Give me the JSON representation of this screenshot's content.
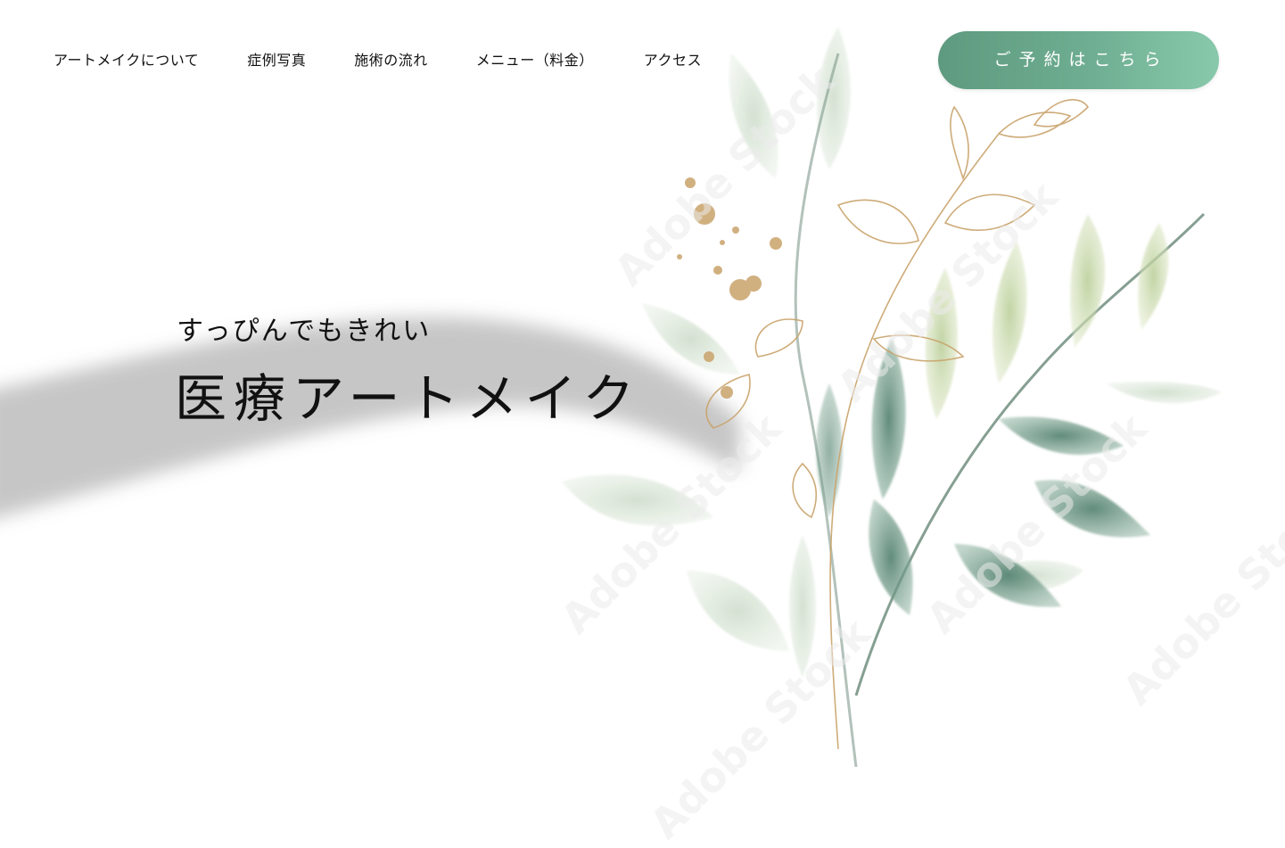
{
  "nav": {
    "items": [
      {
        "label": "アートメイクについて"
      },
      {
        "label": "症例写真"
      },
      {
        "label": "施術の流れ"
      },
      {
        "label": "メニュー（料金）"
      },
      {
        "label": "アクセス"
      }
    ]
  },
  "cta": {
    "label": "ご予約はこちら"
  },
  "hero": {
    "subtitle": "すっぴんでもきれい",
    "title": "医療アートメイク"
  },
  "decor": {
    "watermark_text": "Adobe Stock",
    "brand_color": "#6fae92",
    "leaf_color": "#6f9786",
    "gold_color": "#c9a36b"
  }
}
